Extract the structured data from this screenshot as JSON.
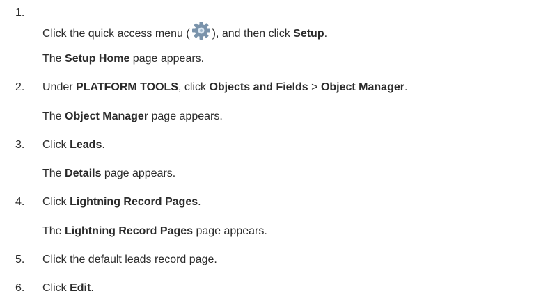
{
  "steps": [
    {
      "number": "1.",
      "instruction": [
        {
          "text": "Click the quick access menu (",
          "bold": false
        },
        {
          "icon": "gear-icon"
        },
        {
          "text": "), and then click ",
          "bold": false
        },
        {
          "text": "Setup",
          "bold": true
        },
        {
          "text": ".",
          "bold": false
        }
      ],
      "result": [
        {
          "text": "The ",
          "bold": false
        },
        {
          "text": "Setup Home",
          "bold": true
        },
        {
          "text": " page appears.",
          "bold": false
        }
      ]
    },
    {
      "number": "2.",
      "instruction": [
        {
          "text": "Under ",
          "bold": false
        },
        {
          "text": "PLATFORM TOOLS",
          "bold": true
        },
        {
          "text": ", click ",
          "bold": false
        },
        {
          "text": "Objects and Fields",
          "bold": true
        },
        {
          "text": " > ",
          "bold": false
        },
        {
          "text": "Object Manager",
          "bold": true
        },
        {
          "text": ".",
          "bold": false
        }
      ],
      "result": [
        {
          "text": "The ",
          "bold": false
        },
        {
          "text": "Object Manager",
          "bold": true
        },
        {
          "text": " page appears.",
          "bold": false
        }
      ]
    },
    {
      "number": "3.",
      "instruction": [
        {
          "text": "Click ",
          "bold": false
        },
        {
          "text": "Leads",
          "bold": true
        },
        {
          "text": ".",
          "bold": false
        }
      ],
      "result": [
        {
          "text": "The ",
          "bold": false
        },
        {
          "text": "Details",
          "bold": true
        },
        {
          "text": " page appears.",
          "bold": false
        }
      ]
    },
    {
      "number": "4.",
      "instruction": [
        {
          "text": "Click ",
          "bold": false
        },
        {
          "text": "Lightning Record Pages",
          "bold": true
        },
        {
          "text": ".",
          "bold": false
        }
      ],
      "result": [
        {
          "text": "The ",
          "bold": false
        },
        {
          "text": "Lightning Record Pages",
          "bold": true
        },
        {
          "text": " page appears.",
          "bold": false
        }
      ]
    },
    {
      "number": "5.",
      "instruction": [
        {
          "text": "Click the default leads record page.",
          "bold": false
        }
      ],
      "result": []
    },
    {
      "number": "6.",
      "instruction": [
        {
          "text": "Click ",
          "bold": false
        },
        {
          "text": "Edit",
          "bold": true
        },
        {
          "text": ".",
          "bold": false
        }
      ],
      "result": []
    }
  ],
  "colors": {
    "text": "#2b2b2b",
    "gear": "#7a93ab",
    "gear_center": "#dbe7f2"
  }
}
